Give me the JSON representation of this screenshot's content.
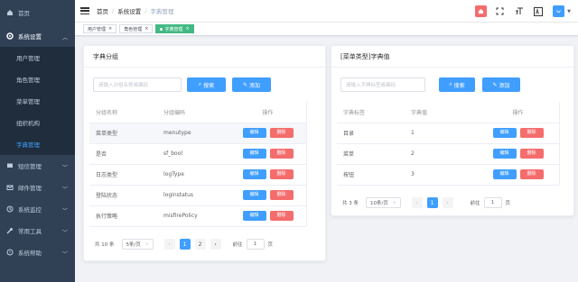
{
  "sidebar": {
    "items": [
      {
        "label": "首页",
        "icon": "home-icon"
      },
      {
        "label": "系统设置",
        "icon": "gear-icon"
      },
      {
        "label": "用户管理"
      },
      {
        "label": "角色管理"
      },
      {
        "label": "菜单管理"
      },
      {
        "label": "组织机构"
      },
      {
        "label": "字典管理"
      },
      {
        "label": "短信管理",
        "icon": "message-icon"
      },
      {
        "label": "邮件管理",
        "icon": "mail-icon"
      },
      {
        "label": "系统监控",
        "icon": "monitor-icon"
      },
      {
        "label": "常用工具",
        "icon": "wrench-icon"
      },
      {
        "label": "系统帮助",
        "icon": "help-icon"
      }
    ]
  },
  "header": {
    "breadcrumb": [
      "首页",
      "系统设置",
      "字典管理"
    ],
    "sep": "/"
  },
  "tags": [
    {
      "label": "用户管理",
      "close": "×"
    },
    {
      "label": "角色管理",
      "close": "×"
    },
    {
      "label": "字典管理",
      "close": "×"
    }
  ],
  "group_card": {
    "title": "字典分组",
    "search_placeholder": "请输入分组名称或编码",
    "search_label": "搜索",
    "add_label": "添加",
    "columns": [
      "分组名称",
      "分组编码",
      "操作"
    ],
    "rows": [
      {
        "name": "菜单类型",
        "code": "menutype"
      },
      {
        "name": "是否",
        "code": "sf_bool"
      },
      {
        "name": "日志类型",
        "code": "logType"
      },
      {
        "name": "登陆状态",
        "code": "loginstatus"
      },
      {
        "name": "执行策略",
        "code": "misfirePolicy"
      }
    ],
    "edit_label": "编辑",
    "delete_label": "删除",
    "pager": {
      "total": "共 10 条",
      "size": "5条/页",
      "pages": [
        "1",
        "2"
      ],
      "goto": "前往",
      "goto_value": "1",
      "page_unit": "页"
    }
  },
  "value_card": {
    "title": "[菜单类型]字典值",
    "search_placeholder": "请输入字典标签或编码",
    "search_label": "搜索",
    "add_label": "添加",
    "columns": [
      "字典标签",
      "字典值",
      "操作"
    ],
    "rows": [
      {
        "label": "目录",
        "value": "1"
      },
      {
        "label": "菜单",
        "value": "2"
      },
      {
        "label": "按钮",
        "value": "3"
      }
    ],
    "edit_label": "编辑",
    "delete_label": "删除",
    "pager": {
      "total": "共 3 条",
      "size": "10条/页",
      "pages": [
        "1"
      ],
      "goto": "前往",
      "goto_value": "1",
      "page_unit": "页"
    }
  },
  "colors": {
    "sidebar_bg": "#304156",
    "primary": "#409eff",
    "danger": "#f56c6c",
    "tag_active": "#42b983"
  }
}
